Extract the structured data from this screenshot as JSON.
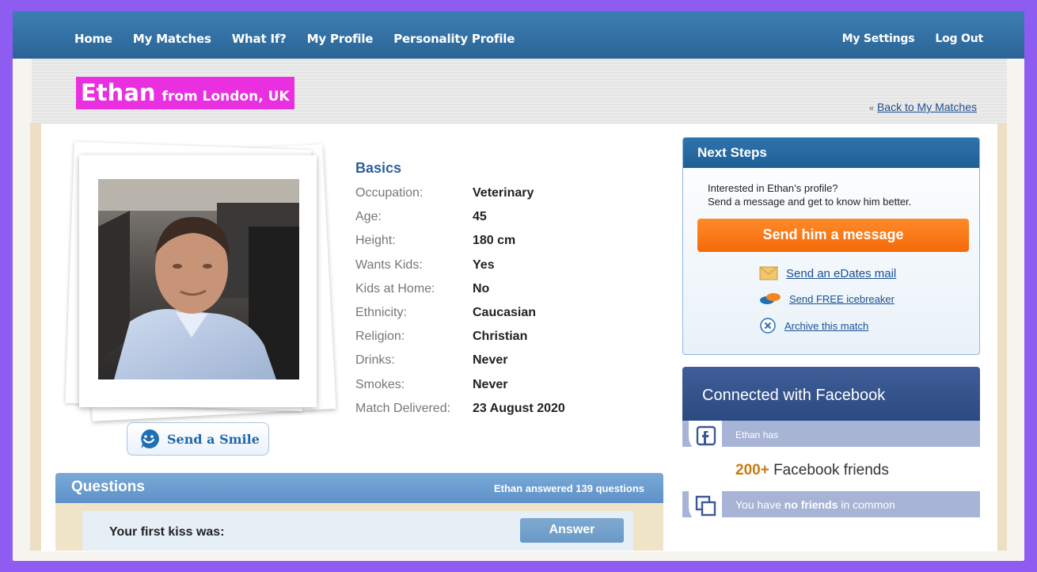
{
  "nav": {
    "left": [
      "Home",
      "My Matches",
      "What If?",
      "My Profile",
      "Personality Profile"
    ],
    "right": [
      "My Settings",
      "Log Out"
    ]
  },
  "profile": {
    "name": "Ethan",
    "location": "from London, UK",
    "back_link": "Back to My Matches",
    "back_prefix": "«",
    "send_smile": "Send a Smile"
  },
  "basics": {
    "title": "Basics",
    "rows": [
      {
        "label": "Occupation:",
        "value": "Veterinary"
      },
      {
        "label": "Age:",
        "value": "45"
      },
      {
        "label": "Height:",
        "value": "180 cm"
      },
      {
        "label": "Wants Kids:",
        "value": "Yes"
      },
      {
        "label": "Kids at Home:",
        "value": "No"
      },
      {
        "label": "Ethnicity:",
        "value": "Caucasian"
      },
      {
        "label": "Religion:",
        "value": "Christian"
      },
      {
        "label": "Drinks:",
        "value": "Never"
      },
      {
        "label": "Smokes:",
        "value": "Never"
      },
      {
        "label": "Match Delivered:",
        "value": "23 August 2020"
      }
    ]
  },
  "questions": {
    "title": "Questions",
    "count": "Ethan answered 139 questions",
    "item": "Your first kiss was:",
    "answer": "Answer"
  },
  "next_steps": {
    "title": "Next Steps",
    "text1": "Interested in Ethan’s profile?",
    "text2": "Send a message and get to know him better.",
    "message_button": "Send him a message",
    "links": [
      "Send an eDates mail",
      "Send FREE icebreaker",
      "Archive this match"
    ]
  },
  "facebook": {
    "title": "Connected with Facebook",
    "has": "Ethan has",
    "friends_count": "200+",
    "friends_label": "Facebook friends",
    "common_prefix": "You have",
    "common_bold": "no friends",
    "common_suffix": "in common"
  },
  "colors": {
    "nav": "#2f6fa4",
    "name_tag": "#ea2fe0",
    "cta": "#f56a08",
    "facebook": "#3b5998",
    "border": "#8e5cf0"
  },
  "icons": [
    "mail-icon",
    "icebreaker-icon",
    "archive-icon",
    "smile-icon",
    "facebook-icon",
    "friends-icon"
  ]
}
